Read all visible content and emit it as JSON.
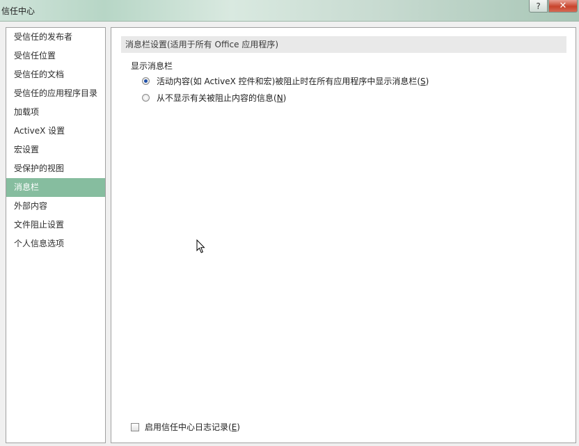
{
  "window": {
    "title": "信任中心",
    "help_label": "?",
    "close_label": "✕"
  },
  "sidebar": {
    "items": [
      {
        "label": "受信任的发布者"
      },
      {
        "label": "受信任位置"
      },
      {
        "label": "受信任的文档"
      },
      {
        "label": "受信任的应用程序目录"
      },
      {
        "label": "加载项"
      },
      {
        "label": "ActiveX 设置"
      },
      {
        "label": "宏设置"
      },
      {
        "label": "受保护的视图"
      },
      {
        "label": "消息栏"
      },
      {
        "label": "外部内容"
      },
      {
        "label": "文件阻止设置"
      },
      {
        "label": "个人信息选项"
      }
    ],
    "selected": "消息栏"
  },
  "main": {
    "section_title": "消息栏设置(适用于所有 Office 应用程序)",
    "group_label": "显示消息栏",
    "options": [
      {
        "label_prefix": "活动内容(如 ActiveX 控件和宏)被阻止时在所有应用程序中显示消息栏(",
        "accel": "S",
        "label_suffix": ")",
        "checked": true
      },
      {
        "label_prefix": "从不显示有关被阻止内容的信息(",
        "accel": "N",
        "label_suffix": ")",
        "checked": false
      }
    ],
    "logging": {
      "label_prefix": "启用信任中心日志记录(",
      "accel": "E",
      "label_suffix": ")",
      "checked": false
    }
  },
  "colors": {
    "selected_item_bg": "#86bd9f",
    "radio_dot": "#1f4fa8"
  }
}
